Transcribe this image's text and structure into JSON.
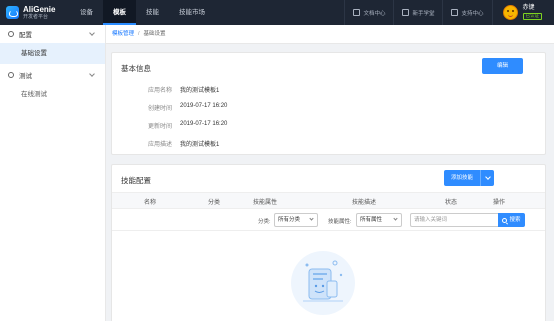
{
  "app": {
    "logo_title": "AliGenie",
    "logo_sub": "开发者平台"
  },
  "nav": {
    "items": [
      "设备",
      "模板",
      "技能",
      "技能市场"
    ],
    "active_index": 1
  },
  "top_links": {
    "docs": "文档中心",
    "newbie": "新手学堂",
    "support": "支持中心"
  },
  "user": {
    "name": "赤键",
    "badge": "已认证"
  },
  "sidebar": {
    "groups": [
      {
        "label": "配置",
        "items": [
          "基础设置"
        ]
      },
      {
        "label": "测试",
        "items": [
          "在线测试"
        ]
      }
    ]
  },
  "breadcrumb": {
    "parent": "模板管理",
    "current": "基础设置"
  },
  "basic_info": {
    "title": "基本信息",
    "edit_label": "编辑",
    "rows": [
      {
        "label": "应用名称",
        "value": "我的测试模板1"
      },
      {
        "label": "创建时间",
        "value": "2019-07-17 16:20"
      },
      {
        "label": "更新时间",
        "value": "2019-07-17 16:20"
      },
      {
        "label": "应用描述",
        "value": "我的测试模板1"
      }
    ]
  },
  "skill_config": {
    "title": "技能配置",
    "add_label": "添加技能",
    "columns": [
      "名称",
      "分类",
      "技能属性",
      "技能描述",
      "状态",
      "操作"
    ],
    "filters": {
      "category_label": "分类:",
      "category_value": "所有分类",
      "attr_label": "技能属性:",
      "attr_value": "所有属性",
      "search_placeholder": "请输入关键词",
      "search_label": "搜索"
    }
  },
  "colors": {
    "accent": "#2f8cff",
    "topbar": "#1e2634"
  }
}
